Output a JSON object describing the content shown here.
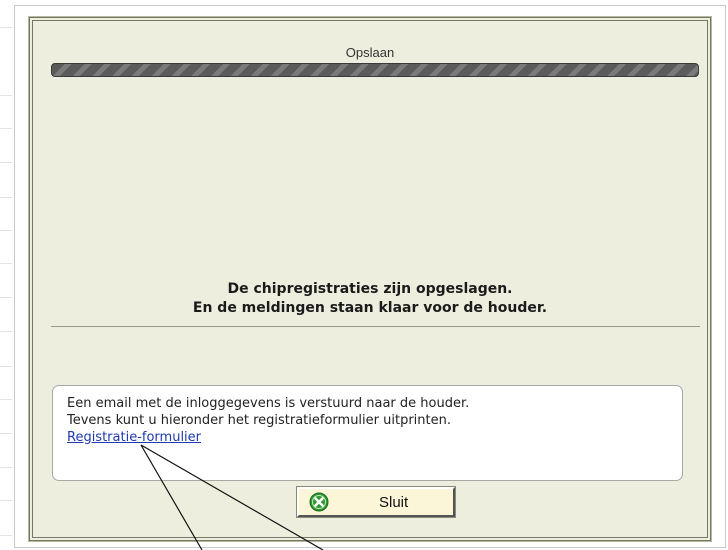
{
  "dialog": {
    "title": "Opslaan",
    "progress": 1.0,
    "message_line1": "De chipregistraties zijn opgeslagen.",
    "message_line2": "En de meldingen staan klaar voor de houder.",
    "info": {
      "line1": "Een email met de inloggegevens is verstuurd naar de houder.",
      "line2": "Tevens kunt u hieronder het registratieformulier uitprinten.",
      "link": "Registratie-formulier"
    },
    "close_label": "Sluit",
    "close_icon": "close-circle-icon",
    "colors": {
      "dialog_bg": "#eeeedf",
      "button_bg": "#fbf6d7",
      "close_icon_green": "#2f9a2f",
      "link": "#1f3ab0"
    }
  }
}
